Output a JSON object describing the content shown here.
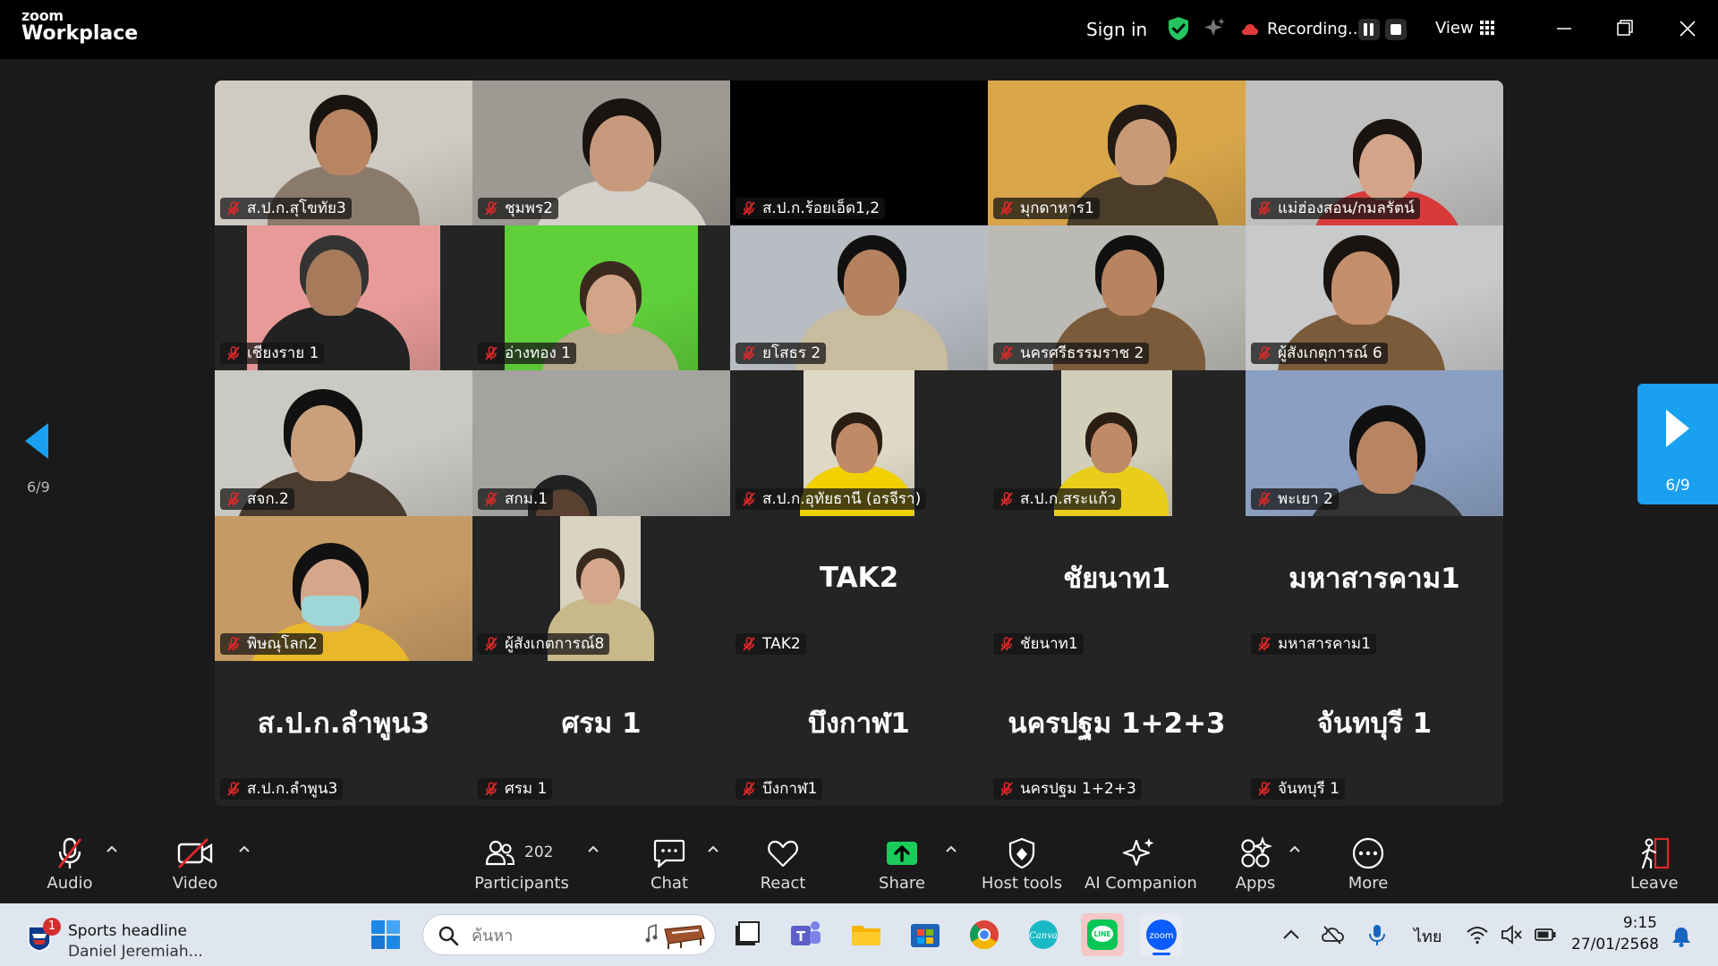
{
  "titlebar": {
    "logo_top": "zoom",
    "logo_bottom": "Workplace",
    "sign_in": "Sign in",
    "recording": "Recording...",
    "view": "View"
  },
  "pagination": {
    "left": "6/9",
    "right": "6/9"
  },
  "tiles": [
    {
      "name": "ส.ป.ก.สุโขทัย3",
      "bg": "#cfcac2"
    },
    {
      "name": "ชุมพร2",
      "bg": "#9d9a93"
    },
    {
      "name": "ส.ป.ก.ร้อยเอ็ด1,2",
      "bg": "#000000"
    },
    {
      "name": "มุกดาหาร1",
      "bg": "#d9a64a"
    },
    {
      "name": "แม่ฮ่องสอน/กมลรัตน์",
      "bg": "#bfbfbd"
    },
    {
      "name": "เชียงราย 1",
      "bg": "#e79a98"
    },
    {
      "name": "อ่างทอง 1",
      "bg": "#5fcf3a"
    },
    {
      "name": "ยโสธร 2",
      "bg": "#b9bcc3"
    },
    {
      "name": "นครศรีธรรมราช 2",
      "bg": "#bcbab4"
    },
    {
      "name": "ผู้สังเกตุการณ์ 6",
      "bg": "#c7c9cb"
    },
    {
      "name": "สจก.2",
      "bg": "#cbc9c4"
    },
    {
      "name": "สกม.1",
      "bg": "#a4a39f"
    },
    {
      "name": "ส.ป.ก.อุทัยธานี (อรจีรา)",
      "bg": "#ded8c6"
    },
    {
      "name": "ส.ป.ก.สระแก้ว",
      "bg": "#d1cfb9"
    },
    {
      "name": "พะเยา 2",
      "bg": "#8b9fc2"
    },
    {
      "name": "พิษณุโลก2",
      "bg": "#c59a64"
    },
    {
      "name": "ผู้สังเกตการณ์8",
      "bg": "#d9d3c2"
    },
    {
      "name": "TAK2",
      "big": "TAK2"
    },
    {
      "name": "ชัยนาท1",
      "big": "ชัยนาท1"
    },
    {
      "name": "มหาสารคาม1",
      "big": "มหาสารคาม1"
    },
    {
      "name": "ส.ป.ก.ลำพูน3",
      "big": "ส.ป.ก.ลำพูน3"
    },
    {
      "name": "ศรม 1",
      "big": "ศรม 1"
    },
    {
      "name": "บึงกาฬ1",
      "big": "บึงกาฬ1"
    },
    {
      "name": "นครปฐม 1+2+3",
      "big": "นครปฐม 1+2+3"
    },
    {
      "name": "จันทบุรี 1",
      "big": "จันทบุรี 1"
    }
  ],
  "toolbar": {
    "audio": "Audio",
    "video": "Video",
    "participants_count": "202",
    "participants": "Participants",
    "chat": "Chat",
    "react": "React",
    "share": "Share",
    "host_tools": "Host tools",
    "ai_companion": "AI Companion",
    "apps": "Apps",
    "more": "More",
    "leave": "Leave"
  },
  "taskbar": {
    "news_badge": "1",
    "news_title": "Sports headline",
    "news_subtitle": "Daniel Jeremiah...",
    "search_placeholder": "ค้นหา",
    "language": "ไทย",
    "time": "9:15",
    "date": "27/01/2568"
  },
  "colors": {
    "accent": "#19a0f0",
    "mic_muted": "#e02828",
    "share_green": "#1bcc5b",
    "shield_green": "#22c55e"
  }
}
